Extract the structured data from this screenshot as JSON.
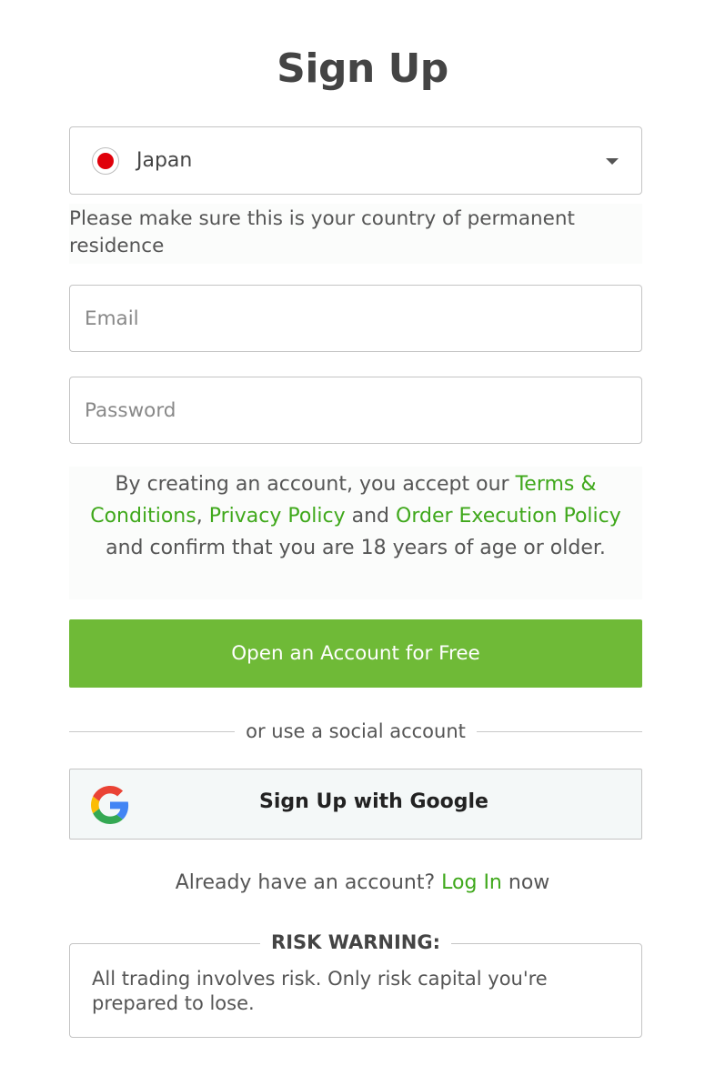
{
  "page": {
    "title": "Sign Up"
  },
  "country": {
    "selected": "Japan",
    "flag_icon": "japan-flag-icon",
    "flag_color": "#e0000a",
    "note": "Please make sure this is your country of permanent residence"
  },
  "fields": {
    "email_placeholder": "Email",
    "password_placeholder": "Password"
  },
  "terms": {
    "part1": "By creating an account, you accept our ",
    "terms_link": "Terms & Conditions",
    "sep1": ", ",
    "privacy_link": "Privacy Policy",
    "sep2": " and ",
    "execution_link": "Order Execution Policy",
    "part2": " and confirm that you are 18 years of age or older."
  },
  "cta": {
    "label": "Open an Account for Free",
    "color": "#6fba37"
  },
  "divider": {
    "label": "or use a social account"
  },
  "google": {
    "label": "Sign Up with Google",
    "icon": "google-icon"
  },
  "login": {
    "prefix": "Already have an account? ",
    "link": "Log In",
    "suffix": " now"
  },
  "risk": {
    "title": "RISK WARNING:",
    "text": "All trading involves risk. Only risk capital you're prepared to lose."
  },
  "colors": {
    "link_green": "#3fa81b"
  }
}
